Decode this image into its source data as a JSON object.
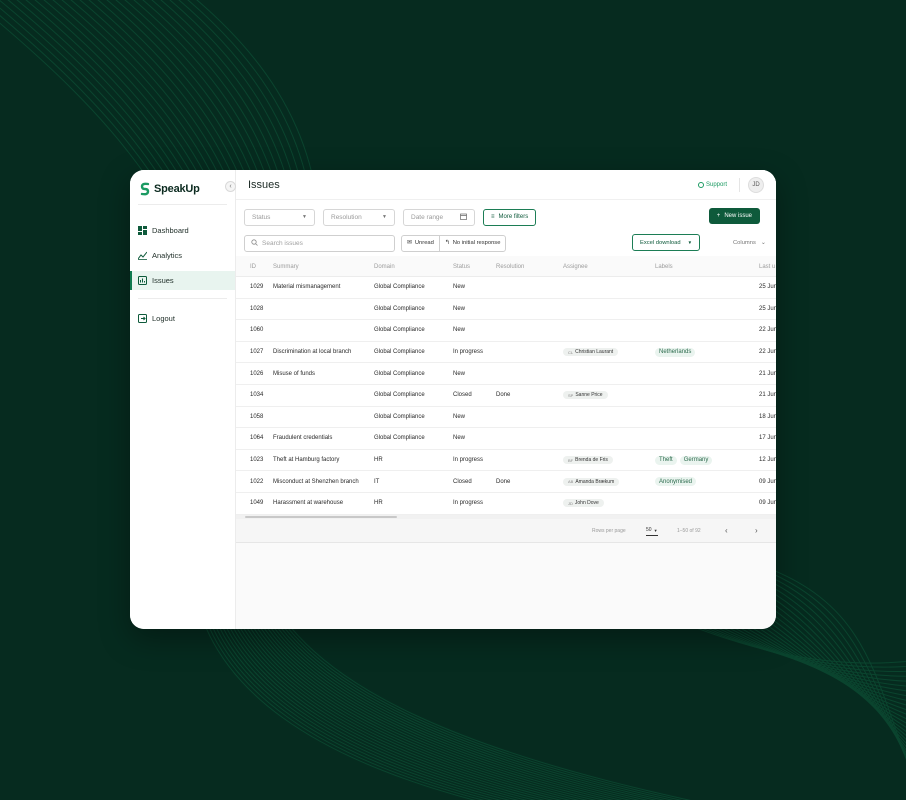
{
  "app": {
    "name": "SpeakUp"
  },
  "sidebar": {
    "items": [
      {
        "label": "Dashboard",
        "icon": "dashboard-icon",
        "active": false
      },
      {
        "label": "Analytics",
        "icon": "analytics-icon",
        "active": false
      },
      {
        "label": "Issues",
        "icon": "issues-icon",
        "active": true
      }
    ],
    "logout_label": "Logout"
  },
  "header": {
    "title": "Issues",
    "support_label": "Support",
    "avatar_initials": "JD"
  },
  "filters": {
    "status": "Status",
    "resolution": "Resolution",
    "date_range": "Date range",
    "more_filters": "More filters",
    "new_issue": "New issue",
    "search_placeholder": "Search issues",
    "unread": "Unread",
    "no_initial_response": "No initial response",
    "excel_download": "Excel download",
    "columns": "Columns"
  },
  "table": {
    "columns": [
      "ID",
      "Summary",
      "Domain",
      "Status",
      "Resolution",
      "Assignee",
      "Labels",
      "Last u"
    ],
    "rows": [
      {
        "id": "1029",
        "summary": "Material mismanagement",
        "domain": "Global Compliance",
        "status": "New",
        "resolution": "",
        "assignee": "",
        "assignee_initials": "",
        "labels": [],
        "last": "25 Jun"
      },
      {
        "id": "1028",
        "summary": "",
        "domain": "Global Compliance",
        "status": "New",
        "resolution": "",
        "assignee": "",
        "assignee_initials": "",
        "labels": [],
        "last": "25 Jun"
      },
      {
        "id": "1060",
        "summary": "",
        "domain": "Global Compliance",
        "status": "New",
        "resolution": "",
        "assignee": "",
        "assignee_initials": "",
        "labels": [],
        "last": "22 Jun"
      },
      {
        "id": "1027",
        "summary": "Discrimination at local branch",
        "domain": "Global Compliance",
        "status": "In progress",
        "resolution": "",
        "assignee": "Christian Laurant",
        "assignee_initials": "CL",
        "labels": [
          "Netherlands"
        ],
        "last": "22 Jun"
      },
      {
        "id": "1026",
        "summary": "Misuse of funds",
        "domain": "Global Compliance",
        "status": "New",
        "resolution": "",
        "assignee": "",
        "assignee_initials": "",
        "labels": [],
        "last": "21 Jun"
      },
      {
        "id": "1034",
        "summary": "",
        "domain": "Global Compliance",
        "status": "Closed",
        "resolution": "Done",
        "assignee": "Sanne Price",
        "assignee_initials": "SP",
        "labels": [],
        "last": "21 Jun"
      },
      {
        "id": "1058",
        "summary": "",
        "domain": "Global Compliance",
        "status": "New",
        "resolution": "",
        "assignee": "",
        "assignee_initials": "",
        "labels": [],
        "last": "18 Jun"
      },
      {
        "id": "1064",
        "summary": "Fraudulent credentials",
        "domain": "Global Compliance",
        "status": "New",
        "resolution": "",
        "assignee": "",
        "assignee_initials": "",
        "labels": [],
        "last": "17 Jun"
      },
      {
        "id": "1023",
        "summary": "Theft at Hamburg factory",
        "domain": "HR",
        "status": "In progress",
        "resolution": "",
        "assignee": "Brenda de Fris",
        "assignee_initials": "BF",
        "labels": [
          "Theft",
          "Germany"
        ],
        "last": "12 Jun"
      },
      {
        "id": "1022",
        "summary": "Misconduct at Shenzhen branch",
        "domain": "IT",
        "status": "Closed",
        "resolution": "Done",
        "assignee": "Amanda Brækum",
        "assignee_initials": "AB",
        "labels": [
          "Anonymised"
        ],
        "last": "09 Jun"
      },
      {
        "id": "1049",
        "summary": "Harassment at warehouse",
        "domain": "HR",
        "status": "In progress",
        "resolution": "",
        "assignee": "John Dove",
        "assignee_initials": "JD",
        "labels": [],
        "last": "09 Jun"
      }
    ]
  },
  "pagination": {
    "rows_per_page_label": "Rows per page",
    "rows_per_page": "50",
    "range": "1–50 of 92"
  },
  "colors": {
    "brand": "#0e5a3b",
    "background": "#062b1f",
    "accent": "#1b9a62"
  }
}
